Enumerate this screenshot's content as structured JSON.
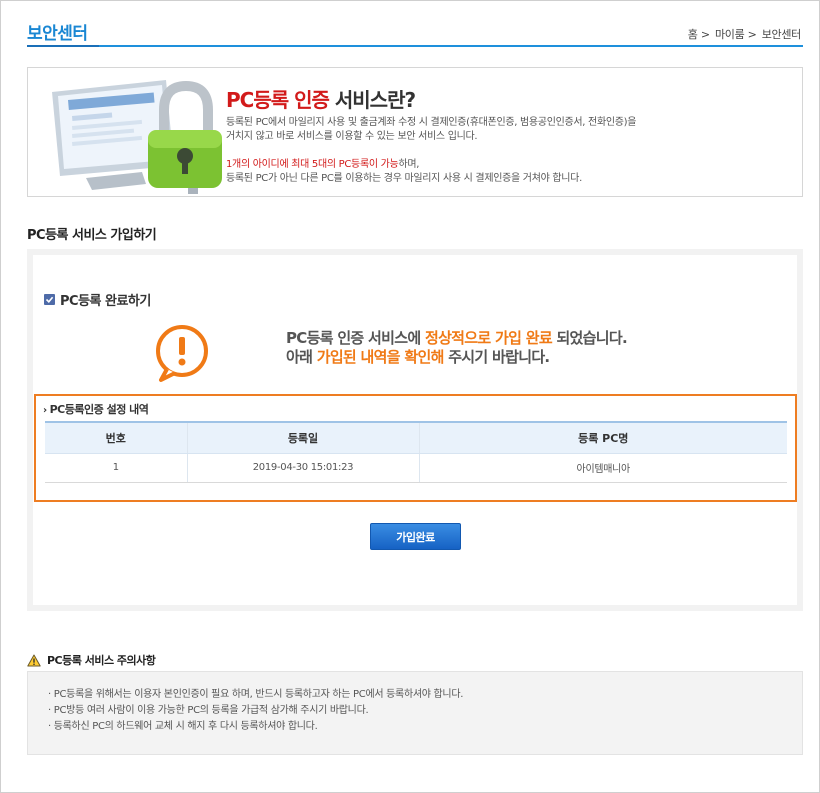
{
  "header": {
    "title": "보안센터",
    "breadcrumb": [
      "홈 >",
      "마이룸 >",
      "보안센터"
    ]
  },
  "intro": {
    "heading_red": "PC등록 인증",
    "heading_rest": " 서비스란?",
    "desc_line1": "등록된 PC에서 마일리지 사용 및 출금계좌 수정 시 결제인증(휴대폰인증, 범용공인인증서, 전화인증)을",
    "desc_line2": "거치지 않고 바로 서비스를 이용할 수 있는 보안 서비스 입니다.",
    "note_red": "1개의 아이디에 최대 5대의 PC등록이 가능",
    "note_rest": "하며,",
    "note_line2": "등록된 PC가 아닌 다른 PC를 이용하는 경우 마일리지 사용 시 결제인증을 거쳐야 합니다."
  },
  "section": {
    "title": "PC등록 서비스 가입하기",
    "complete_label": "PC등록 완료하기"
  },
  "message": {
    "line1_a": "PC등록 인증 서비스에 ",
    "line1_b": "정상적으로 가입 완료",
    "line1_c": " 되었습니다.",
    "line2_a": "아래 ",
    "line2_b": "가입된 내역을 확인해",
    "line2_c": " 주시기 바랍니다."
  },
  "table": {
    "caption": "PC등록인증 설정 내역",
    "headers": [
      "번호",
      "등록일",
      "등록 PC명"
    ],
    "rows": [
      {
        "no": "1",
        "date": "2019-04-30 15:01:23",
        "pc_name": "아이템매니아"
      }
    ]
  },
  "buttons": {
    "confirm": "가입완료"
  },
  "caution": {
    "title": "PC등록 서비스 주의사항",
    "items": [
      "· PC등록을 위해서는 이용자 본인인증이 필요 하며, 반드시 등록하고자 하는 PC에서 등록하셔야 합니다.",
      "· PC방등 여러 사람이 이용 가능한 PC의 등록을 가급적 삼가해 주시기 바랍니다.",
      "· 등록하신 PC의 하드웨어 교체 시 해지 후 다시 등록하셔야 합니다."
    ]
  },
  "colors": {
    "accent_blue": "#1a87d3",
    "highlight_orange": "#ee7d22",
    "red": "#d21a1a"
  },
  "icons": {
    "checkbox": "checkbox-checked-icon",
    "alert": "exclamation-bubble-icon",
    "caution": "warning-triangle-icon",
    "banner": "computer-padlock-icon"
  }
}
